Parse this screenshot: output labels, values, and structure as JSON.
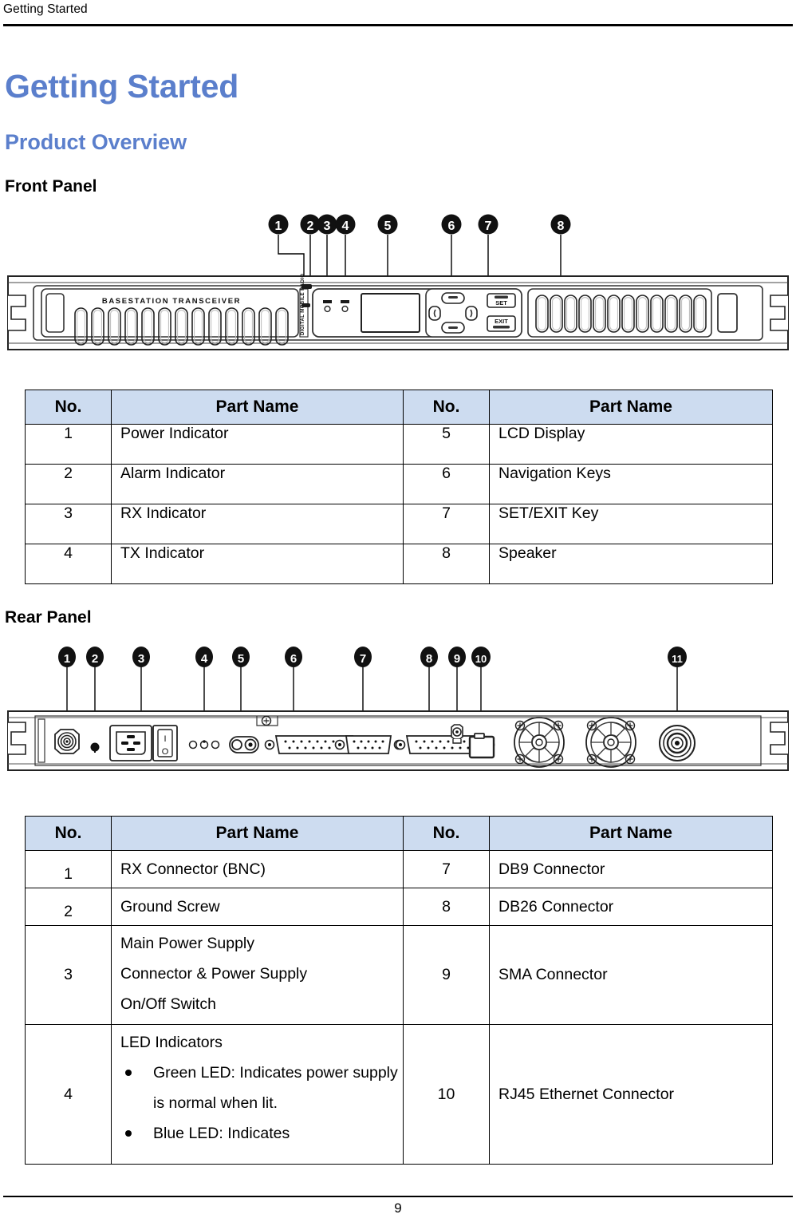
{
  "running_header": {
    "text": "Getting Started"
  },
  "headings": {
    "h1": "Getting Started",
    "h2": "Product Overview",
    "front_panel": "Front Panel",
    "rear_panel": "Rear Panel"
  },
  "front_figure": {
    "device_label": "BASESTATION TRANSCEIVER",
    "set_key_label": "SET",
    "exit_key_label": "EXIT",
    "callouts": [
      "1",
      "2",
      "3",
      "4",
      "5",
      "6",
      "7",
      "8"
    ]
  },
  "rear_figure": {
    "switch_on_label": "I",
    "switch_off_label": "O",
    "callouts": [
      "1",
      "2",
      "3",
      "4",
      "5",
      "6",
      "7",
      "8",
      "9",
      "10",
      "11"
    ]
  },
  "front_table": {
    "headers": [
      "No.",
      "Part Name",
      "No.",
      "Part Name"
    ],
    "rows": [
      {
        "no_left": "1",
        "name_left": "Power Indicator",
        "no_right": "5",
        "name_right": "LCD Display"
      },
      {
        "no_left": "2",
        "name_left": "Alarm Indicator",
        "no_right": "6",
        "name_right": "Navigation Keys"
      },
      {
        "no_left": "3",
        "name_left": "RX Indicator",
        "no_right": "7",
        "name_right": "SET/EXIT Key"
      },
      {
        "no_left": "4",
        "name_left": "TX Indicator",
        "no_right": "8",
        "name_right": "Speaker"
      }
    ]
  },
  "rear_table": {
    "headers": [
      "No.",
      "Part Name",
      "No.",
      "Part Name"
    ],
    "rows": [
      {
        "no_left": "1",
        "name_left": "RX Connector (BNC)",
        "no_right": "7",
        "name_right": "DB9 Connector"
      },
      {
        "no_left": "2",
        "name_left": "Ground Screw",
        "no_right": "8",
        "name_right": "DB26 Connector"
      },
      {
        "no_left": "3",
        "name_left_lines": [
          "Main Power Supply",
          "Connector & Power Supply",
          "On/Off Switch"
        ],
        "no_right": "9",
        "name_right": "SMA Connector"
      },
      {
        "no_left": "4",
        "led_heading": "LED Indicators",
        "bullets": [
          "Green LED: Indicates power supply is normal when lit.",
          "Blue LED: Indicates"
        ],
        "no_right": "10",
        "name_right": "RJ45 Ethernet Connector"
      }
    ]
  },
  "footer": {
    "page_number": "9"
  },
  "colors": {
    "accent_heading": "#5B7FCC",
    "table_header_bg": "#CDDCF0",
    "rule": "#000000"
  }
}
